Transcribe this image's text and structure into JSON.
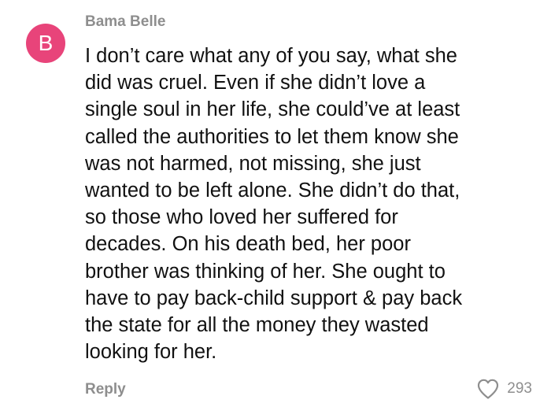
{
  "comment": {
    "author": "Bama Belle",
    "avatar_letter": "B",
    "text": "I don’t care what any of you say, what she\ndid was cruel. Even if she didn’t love a\nsingle soul in her life, she could’ve at least\ncalled the authorities to let them know she\nwas not harmed, not missing, she just\nwanted to be left alone. She didn’t do that,\nso those who loved her suffered for\ndecades. On his death bed, her poor\nbrother was thinking of her. She ought to\nhave to pay back-child support & pay back\nthe state for all the money they wasted\nlooking for her.",
    "reply_label": "Reply",
    "like_count": "293",
    "like_icon": "heart-outline-icon"
  },
  "colors": {
    "avatar_bg": "#e8447a",
    "meta_text": "#8e8e8e",
    "body_text": "#111111"
  }
}
